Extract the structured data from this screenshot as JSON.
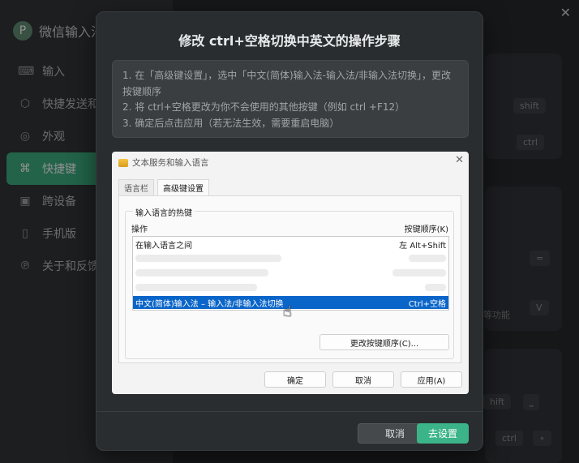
{
  "app": {
    "brand_logo": "P",
    "brand_name": "微信输入法",
    "close_icon": "✕"
  },
  "sidebar": {
    "items": [
      {
        "icon": "keyboard-icon",
        "glyph": "⌨",
        "label": "输入"
      },
      {
        "icon": "cube-icon",
        "glyph": "⬡",
        "label": "快捷发送和"
      },
      {
        "icon": "palette-icon",
        "glyph": "◎",
        "label": "外观"
      },
      {
        "icon": "command-icon",
        "glyph": "⌘",
        "label": "快捷键",
        "active": true
      },
      {
        "icon": "devices-icon",
        "glyph": "▣",
        "label": "跨设备"
      },
      {
        "icon": "phone-icon",
        "glyph": "▯",
        "label": "手机版"
      },
      {
        "icon": "about-icon",
        "glyph": "℗",
        "label": "关于和反馈"
      }
    ]
  },
  "background": {
    "pills": [
      "shift",
      "ctrl",
      "=",
      "V",
      "hift",
      "⎵",
      "ctrl",
      "∘"
    ],
    "fragment_text": "等功能"
  },
  "modal": {
    "title": "修改 ctrl+空格切换中英文的操作步骤",
    "steps": [
      "1. 在「高级键设置」，选中「中文(简体)输入法-输入法/非输入法切换」，更改按键顺序",
      "2. 将 ctrl+空格更改为你不会使用的其他按键（例如 ctrl +F12）",
      "3. 确定后点击应用（若无法生效，需要重启电脑）"
    ],
    "cancel_label": "取消",
    "confirm_label": "去设置"
  },
  "win_dialog": {
    "title": "文本服务和输入语言",
    "close": "✕",
    "tabs": [
      "语言栏",
      "高级键设置"
    ],
    "active_tab": "高级键设置",
    "group_label": "输入语言的热键",
    "col_action": "操作",
    "col_key": "按键顺序(K)",
    "rows": [
      {
        "action": "在输入语言之间",
        "key": "左 Alt+Shift"
      },
      {
        "action": "中文(简体)输入法 – 输入法/非输入法切换",
        "key": "Ctrl+空格",
        "selected": true
      }
    ],
    "change_btn": "更改按键顺序(C)...",
    "ok_btn": "确定",
    "cancel_btn": "取消",
    "apply_btn": "应用(A)"
  }
}
